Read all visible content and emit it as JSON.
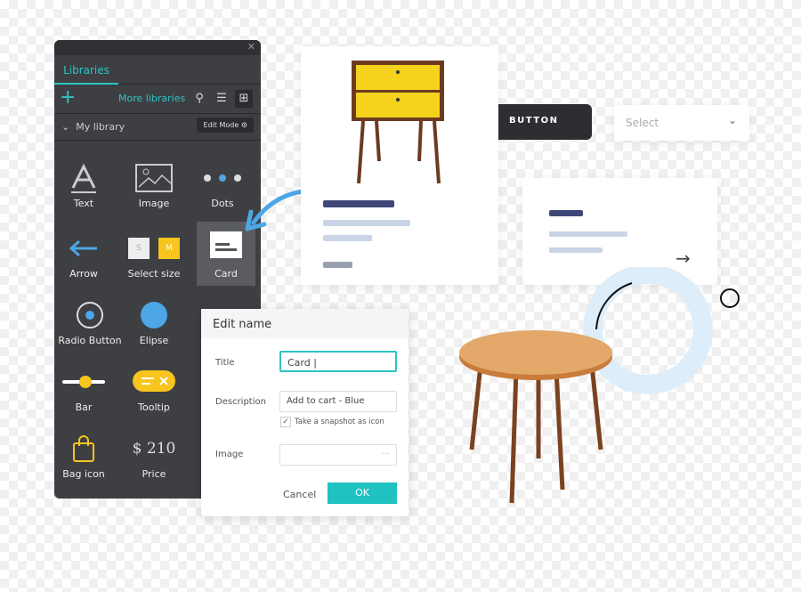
{
  "panel": {
    "tab": "Libraries",
    "more_libraries": "More libraries",
    "section": "My library",
    "edit_mode": "Edit Mode",
    "items": [
      {
        "label": "Text",
        "icon": "text-icon"
      },
      {
        "label": "Image",
        "icon": "image-icon"
      },
      {
        "label": "Dots",
        "icon": "dots-icon"
      },
      {
        "label": "Arrow",
        "icon": "arrow-left-icon"
      },
      {
        "label": "Select size",
        "icon": "size-select-icon",
        "s": "S",
        "m": "M"
      },
      {
        "label": "Card",
        "icon": "card-icon"
      },
      {
        "label": "Radio Button",
        "icon": "radio-icon"
      },
      {
        "label": "Elipse",
        "icon": "ellipse-icon"
      },
      {
        "label": "Bar",
        "icon": "slider-icon"
      },
      {
        "label": "Tooltip",
        "icon": "tooltip-icon"
      },
      {
        "label": "Bag icon",
        "icon": "bag-icon"
      },
      {
        "label": "Price",
        "icon": "price-icon",
        "price": "$ 210"
      }
    ]
  },
  "canvas": {
    "button_label": "BUTTON",
    "select_placeholder": "Select"
  },
  "dialog": {
    "title": "Edit name",
    "title_label": "Title",
    "title_value": "Card |",
    "description_label": "Description",
    "description_value": "Add to cart - Blue",
    "snapshot_label": "Take a snapshot as icon",
    "snapshot_checked": true,
    "image_label": "Image",
    "image_dots": "···",
    "cancel": "Cancel",
    "ok": "OK"
  },
  "colors": {
    "accent": "#1fc1c1",
    "panel": "#3d3f43",
    "blue": "#4da6e6",
    "yellow": "#f7c51e"
  }
}
